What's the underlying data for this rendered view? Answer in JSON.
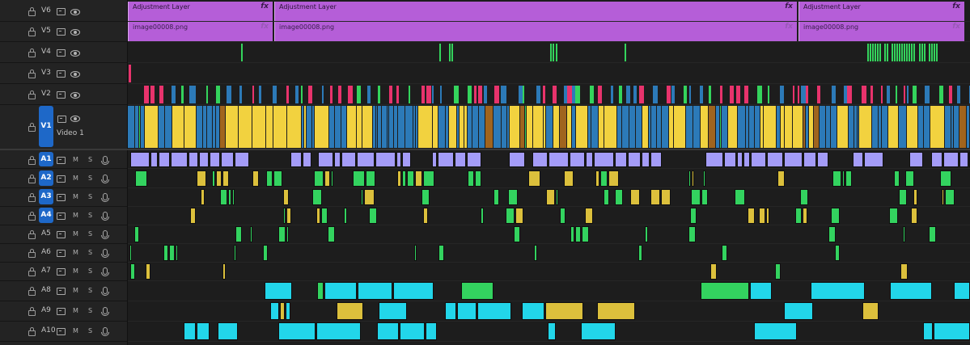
{
  "colors": {
    "accent": "#1e68c8",
    "adjustment": "#b55ed8",
    "video_yellow": "#f2d23f",
    "video_blue": "#2c7ab8",
    "video_brown": "#a0641e",
    "video_purple": "#8f2fe8",
    "video_pink": "#e8336c",
    "video_green": "#34d45c",
    "audio_purple": "#a49cf8",
    "audio_cyan": "#22d6ea",
    "audio_green": "#33d35f",
    "audio_yellow": "#dcc03c"
  },
  "icons": {
    "lock": "lock-icon",
    "sync": "film-icon",
    "visibility": "eye-icon",
    "voiceover": "mic-icon"
  },
  "video_tracks": [
    {
      "id": "V6",
      "label": "V6",
      "targeted": false,
      "name": ""
    },
    {
      "id": "V5",
      "label": "V5",
      "targeted": false,
      "name": ""
    },
    {
      "id": "V4",
      "label": "V4",
      "targeted": false,
      "name": ""
    },
    {
      "id": "V3",
      "label": "V3",
      "targeted": false,
      "name": ""
    },
    {
      "id": "V2",
      "label": "V2",
      "targeted": false,
      "name": ""
    },
    {
      "id": "V1",
      "label": "V1",
      "targeted": true,
      "name": "Video 1"
    }
  ],
  "audio_tracks": [
    {
      "id": "A1",
      "label": "A1",
      "targeted": true,
      "mute": "M",
      "solo": "S"
    },
    {
      "id": "A2",
      "label": "A2",
      "targeted": true,
      "mute": "M",
      "solo": "S"
    },
    {
      "id": "A3",
      "label": "A3",
      "targeted": true,
      "mute": "M",
      "solo": "S"
    },
    {
      "id": "A4",
      "label": "A4",
      "targeted": true,
      "mute": "M",
      "solo": "S"
    },
    {
      "id": "A5",
      "label": "A5",
      "targeted": false,
      "mute": "M",
      "solo": "S"
    },
    {
      "id": "A6",
      "label": "A6",
      "targeted": false,
      "mute": "M",
      "solo": "S"
    },
    {
      "id": "A7",
      "label": "A7",
      "targeted": false,
      "mute": "M",
      "solo": "S"
    },
    {
      "id": "A8",
      "label": "A8",
      "targeted": false,
      "mute": "M",
      "solo": "S"
    },
    {
      "id": "A9",
      "label": "A9",
      "targeted": false,
      "mute": "M",
      "solo": "S"
    },
    {
      "id": "A10",
      "label": "A10",
      "targeted": false,
      "mute": "M",
      "solo": "S"
    }
  ],
  "v6_clips": [
    {
      "label": "Adjustment Layer",
      "fx": "fx"
    },
    {
      "label": "Adjustment Layer",
      "fx": "fx"
    },
    {
      "label": "Adjustment Layer",
      "fx": "fx"
    }
  ],
  "v5_clips": [
    {
      "label": "image00008.png",
      "fx": "fx"
    },
    {
      "label": "image00008.png",
      "fx": "fx"
    },
    {
      "label": "image00008.png",
      "fx": "fx"
    }
  ]
}
